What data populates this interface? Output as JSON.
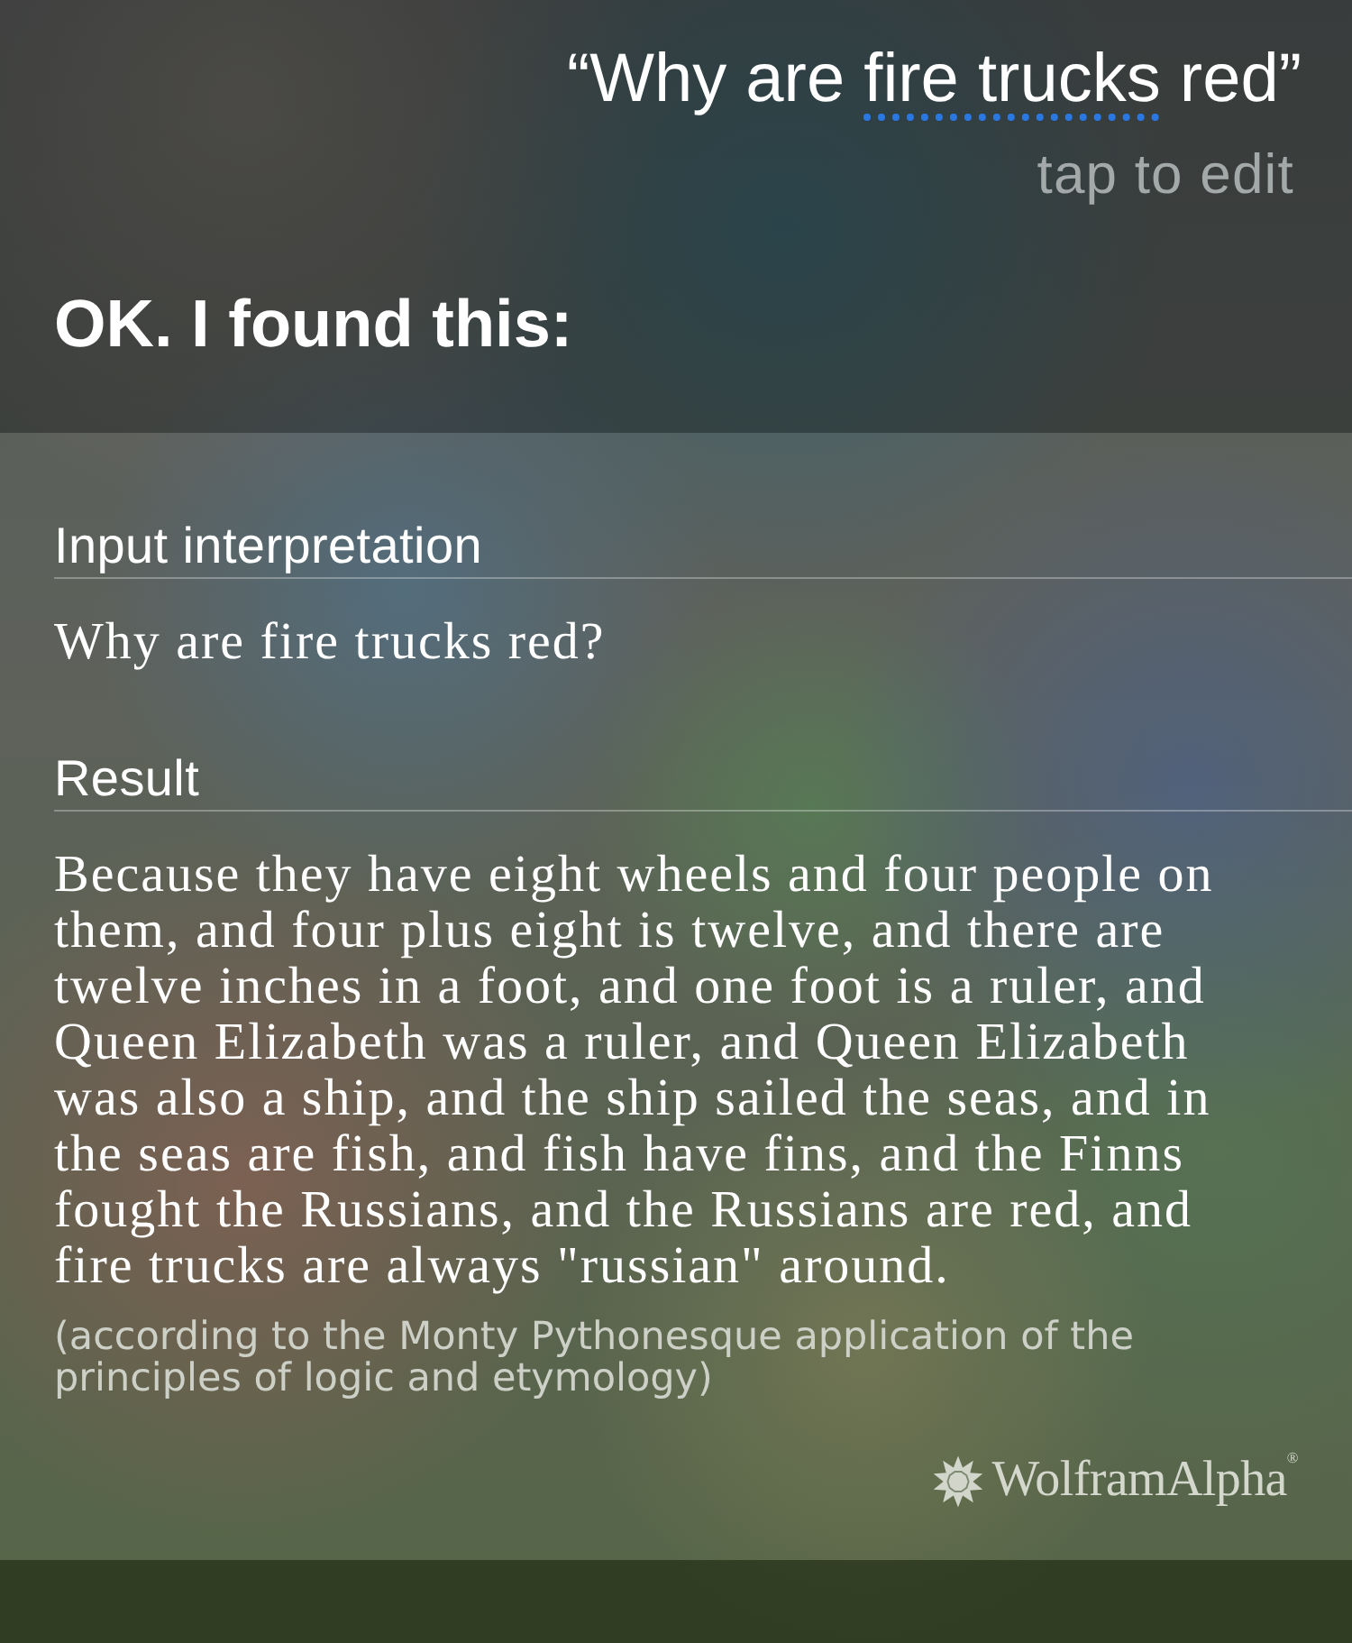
{
  "query": {
    "parts": [
      {
        "text": "“Why are ",
        "underlined": false
      },
      {
        "text": "fire trucks",
        "underlined": true
      },
      {
        "text": " red”",
        "underlined": false
      }
    ]
  },
  "edit_hint": "tap to edit",
  "reply": "OK. I found this:",
  "sections": [
    {
      "heading": "Input interpretation",
      "text": "Why are fire trucks red?"
    },
    {
      "heading": "Result",
      "text": "Because they have eight wheels and four people on them, and four plus eight is twelve, and there are twelve inches in a foot, and one foot is a ruler, and Queen Elizabeth was a ruler, and Queen Elizabeth was also a ship, and the ship sailed the seas, and in the seas are fish, and fish have fins, and the Finns fought the Russians, and the Russians are red, and fire trucks are always \"russian\" around.",
      "note": "(according to the Monty Pythonesque application of the principles of logic and etymology)"
    }
  ],
  "attribution": "WolframAlpha$^{®}$"
}
